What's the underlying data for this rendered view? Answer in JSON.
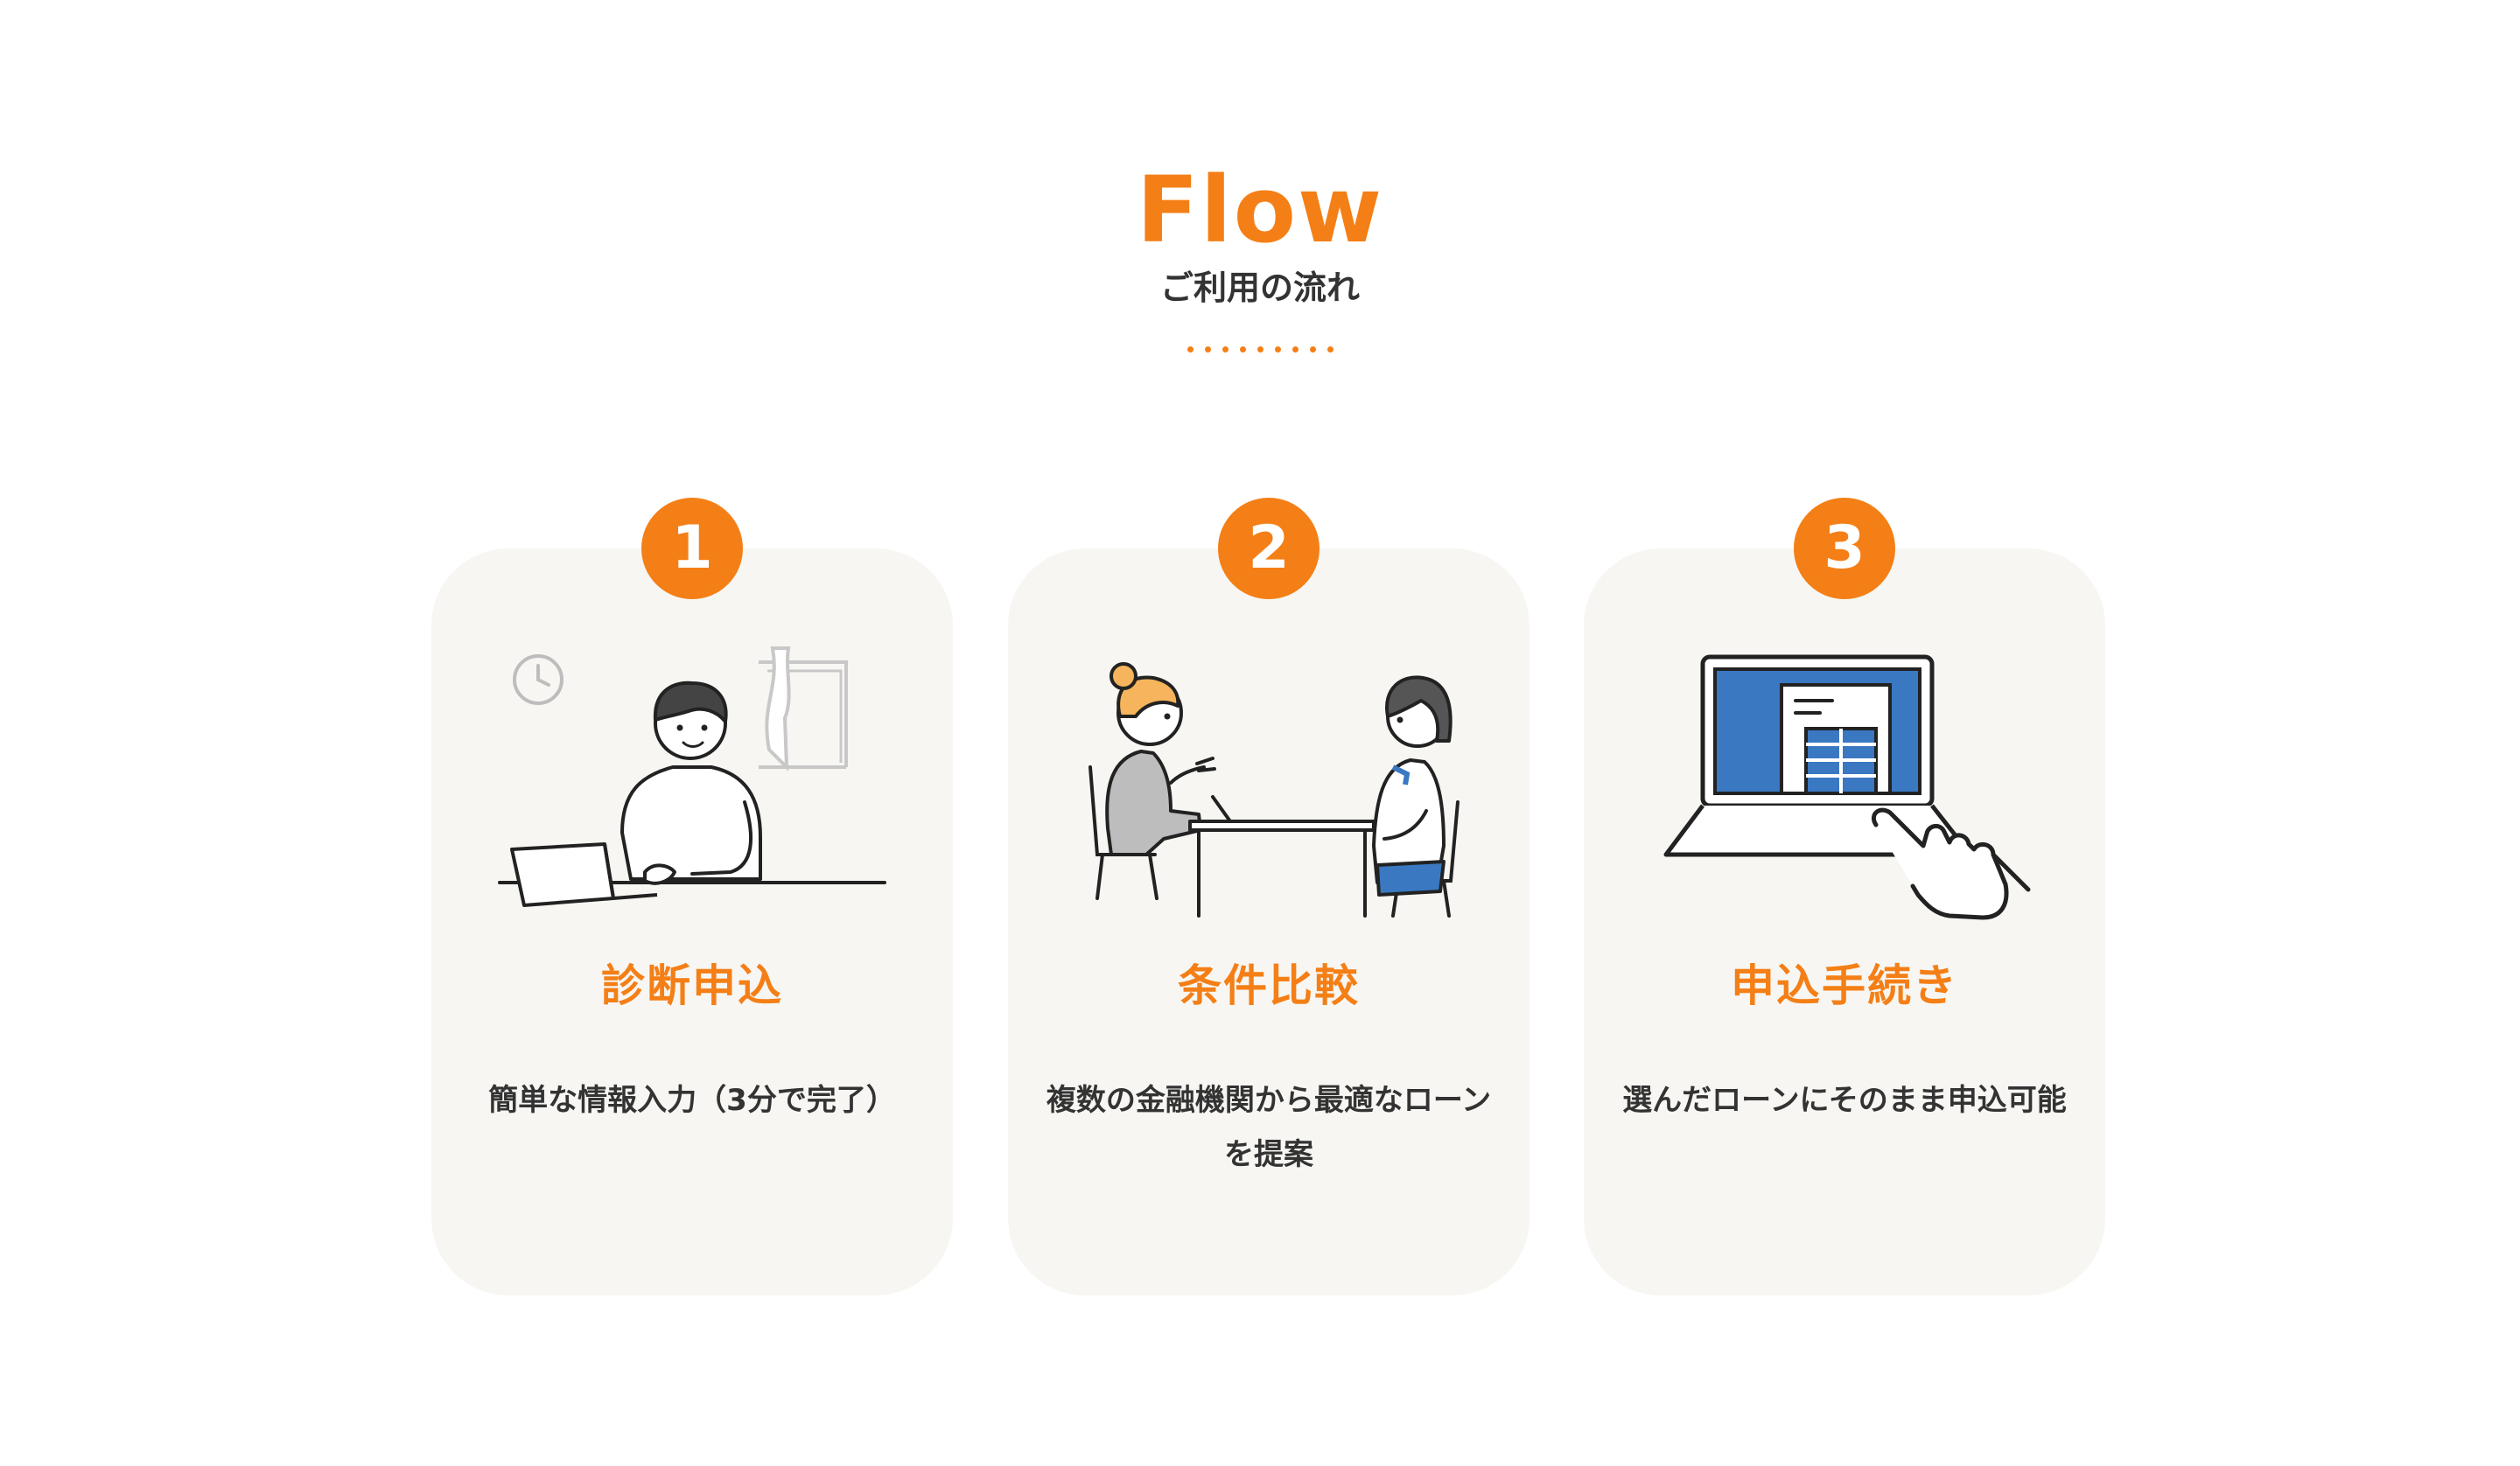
{
  "section": {
    "title": "Flow",
    "subtitle": "ご利用の流れ",
    "accent_color": "#f47f16",
    "card_background": "#f7f6f2",
    "divider_dot_count": 9
  },
  "steps": [
    {
      "number": "1",
      "title": "診断申込",
      "description": "簡単な情報入力（3分で完了）",
      "illustration": "person-at-laptop-illustration"
    },
    {
      "number": "2",
      "title": "条件比較",
      "description": "複数の金融機関から最適なローンを提案",
      "illustration": "consultation-meeting-illustration"
    },
    {
      "number": "3",
      "title": "申込手続き",
      "description": "選んだローンにそのまま申込可能",
      "illustration": "laptop-tap-illustration"
    }
  ]
}
